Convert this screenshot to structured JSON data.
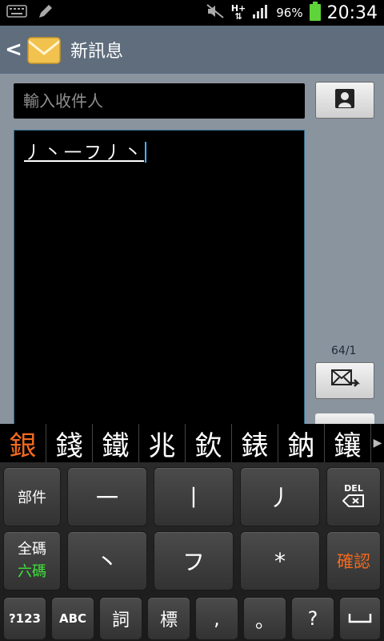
{
  "status_bar": {
    "left_icons": [
      "keyboard-icon",
      "edit-pencil-icon"
    ],
    "right_icons": [
      "mute-icon",
      "hplus-network-icon",
      "signal-icon",
      "battery-icon"
    ],
    "network_label": "H+",
    "battery_percent": "96%",
    "time": "20:34"
  },
  "header": {
    "back_icon": "back-chevron-icon",
    "app_icon": "message-envelope-icon",
    "title": "新訊息"
  },
  "compose": {
    "recipient_placeholder": "輸入收件人",
    "contact_button_icon": "contact-person-icon",
    "message_text": "丿丶一フ丿丶",
    "char_counter": "64/1",
    "send_button_icon": "send-mail-icon"
  },
  "candidates": {
    "items": [
      "銀",
      "錢",
      "鐵",
      "兆",
      "欽",
      "錶",
      "鈉",
      "鑲"
    ],
    "active_index": 0,
    "more_icon": "right-triangle-icon"
  },
  "keyboard": {
    "row1": [
      "部件",
      "一",
      "丨",
      "丿",
      "DEL"
    ],
    "row2": [
      "全碼",
      "六碼",
      "丶",
      "フ",
      "*",
      "確認"
    ],
    "row3": [
      "?123",
      "ABC",
      "詞",
      "標",
      ",",
      "。",
      "?",
      "space"
    ],
    "colors": {
      "accent_orange": "#f06a1e",
      "accent_green": "#3ee53a"
    }
  }
}
